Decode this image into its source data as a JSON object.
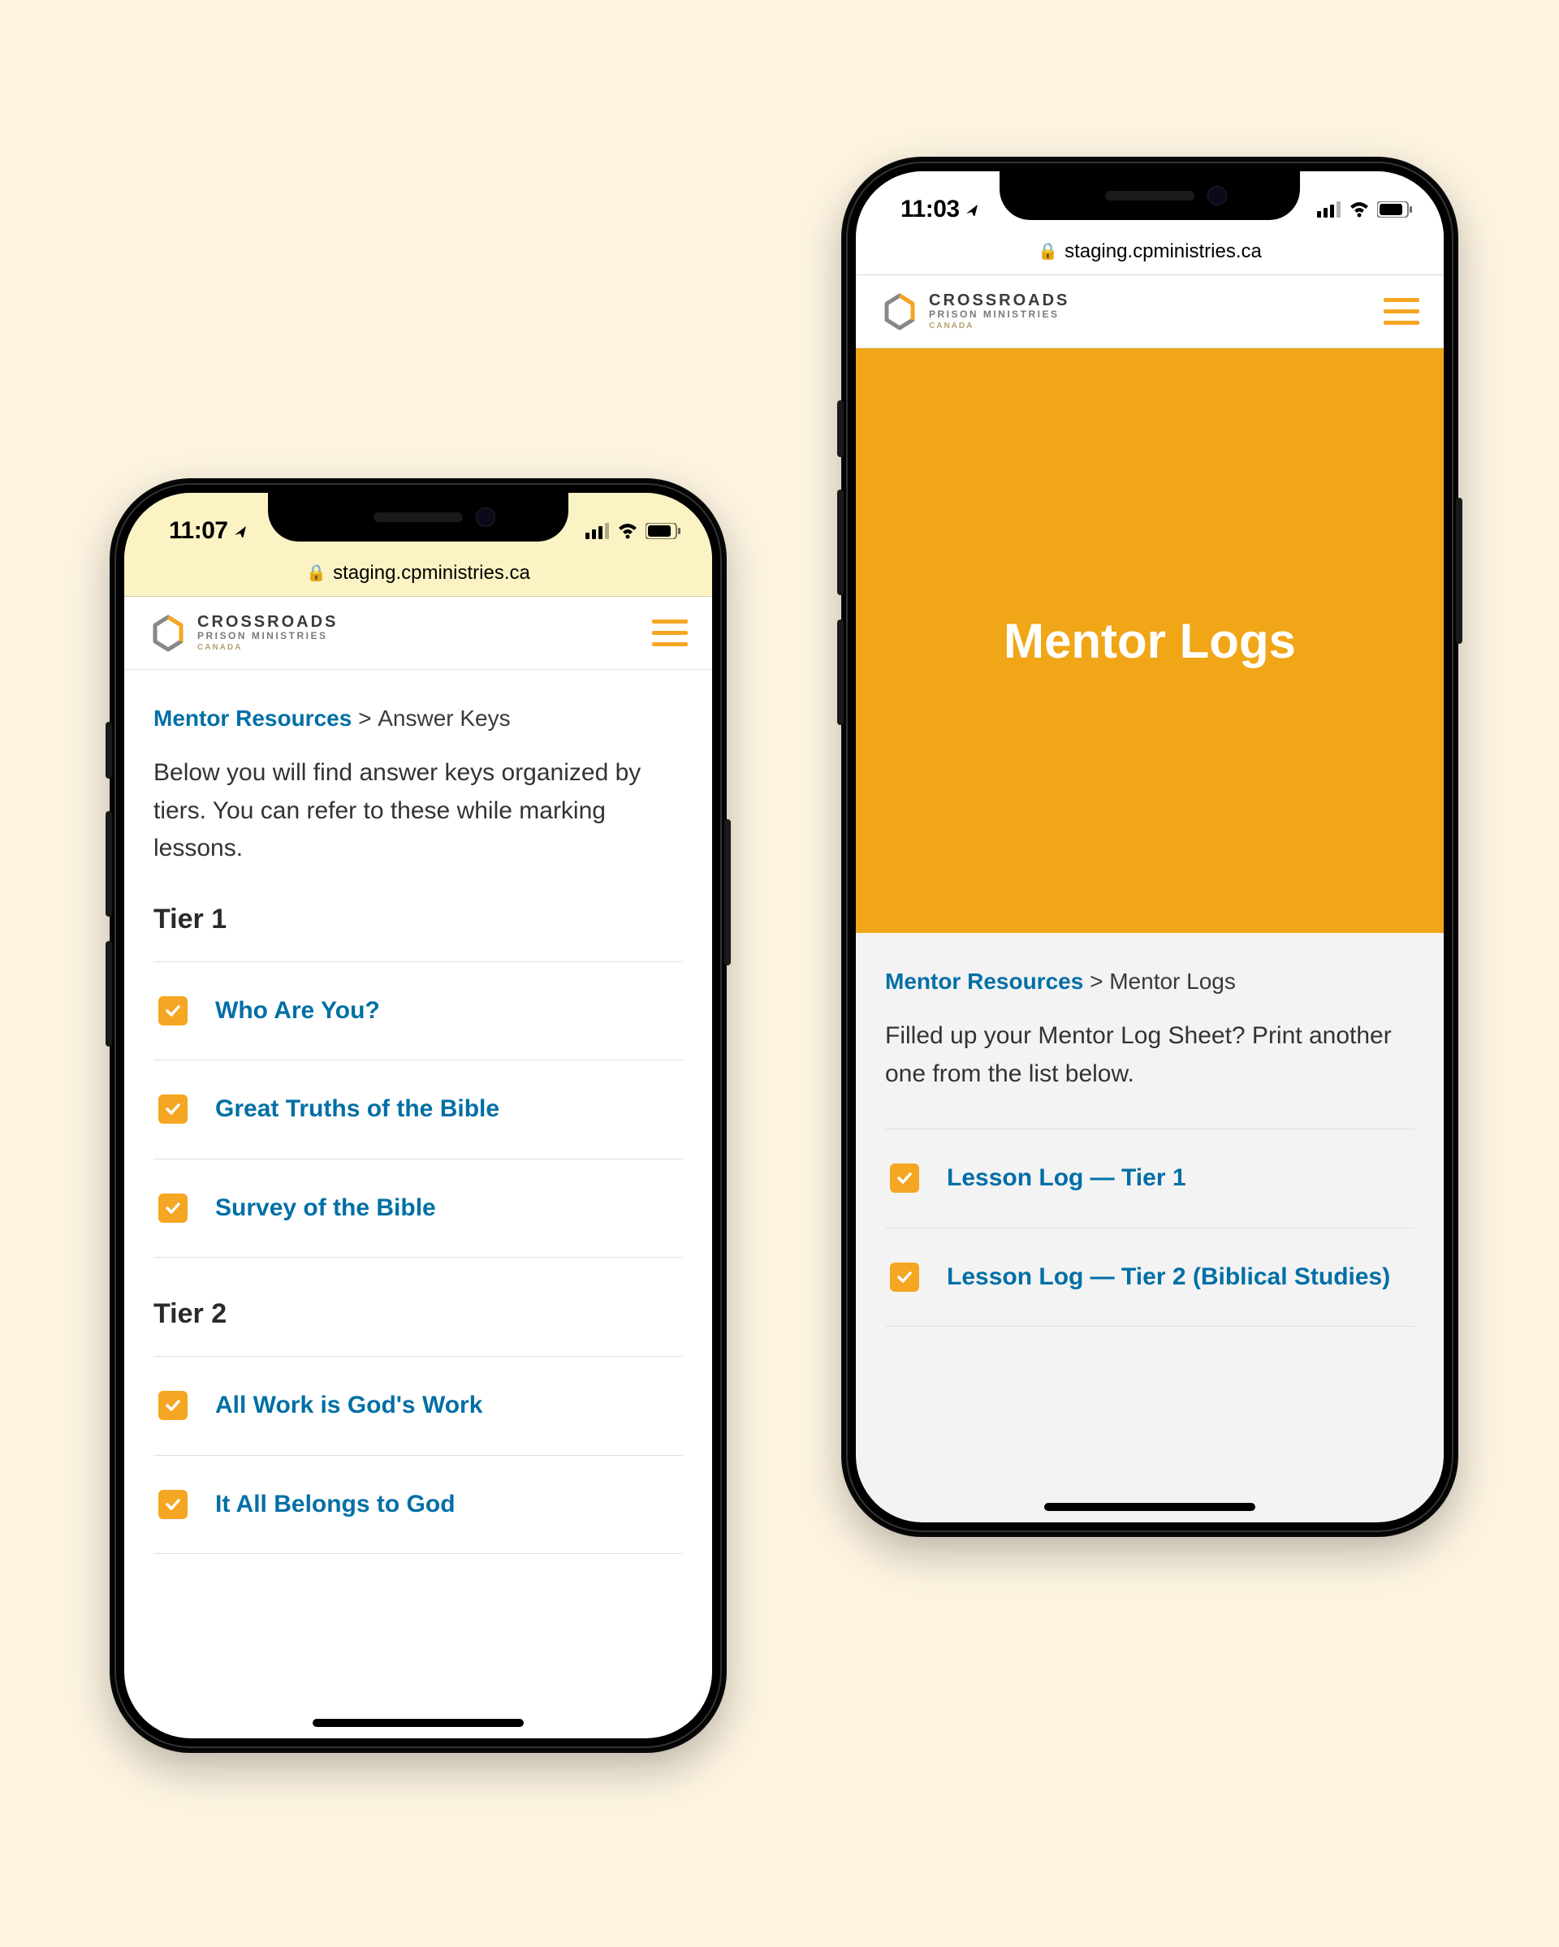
{
  "phone1": {
    "status_time": "11:07",
    "url": "staging.cpministries.ca",
    "logo": {
      "l1": "CROSSROADS",
      "l2": "PRISON MINISTRIES",
      "l3": "CANADA"
    },
    "breadcrumb": {
      "link": "Mentor Resources",
      "sep": ">",
      "current": "Answer Keys"
    },
    "intro": "Below you will find answer keys organized by tiers. You can refer to these while marking lessons.",
    "tier1_heading": "Tier 1",
    "tier1_items": [
      "Who Are You?",
      "Great Truths of the Bible",
      "Survey of the Bible"
    ],
    "tier2_heading": "Tier 2",
    "tier2_items": [
      "All Work is God's Work",
      "It All Belongs to God"
    ]
  },
  "phone2": {
    "status_time": "11:03",
    "url": "staging.cpministries.ca",
    "logo": {
      "l1": "CROSSROADS",
      "l2": "PRISON MINISTRIES",
      "l3": "CANADA"
    },
    "hero_title": "Mentor Logs",
    "breadcrumb": {
      "link": "Mentor Resources",
      "sep": ">",
      "current": "Mentor Logs"
    },
    "intro": "Filled up your Mentor Log Sheet? Print another one from the list below.",
    "items": [
      "Lesson Log — Tier 1",
      "Lesson Log — Tier 2 (Biblical Studies)"
    ]
  },
  "colors": {
    "accent": "#f5a623",
    "link": "#006fa6"
  }
}
